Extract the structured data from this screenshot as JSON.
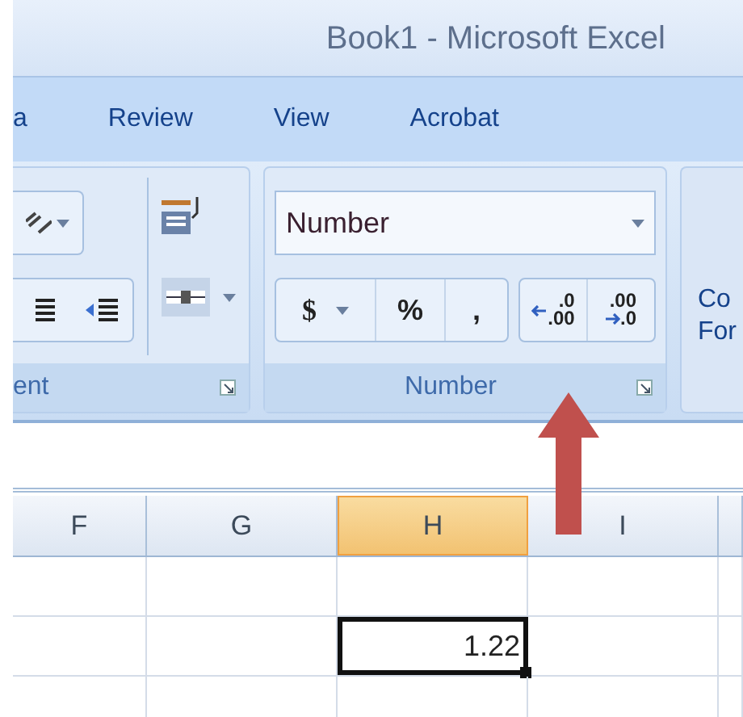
{
  "window": {
    "title": "Book1  -  Microsoft Excel"
  },
  "tabs": [
    {
      "label": "a",
      "selected": false
    },
    {
      "label": "Review",
      "selected": false
    },
    {
      "label": "View",
      "selected": false
    },
    {
      "label": "Acrobat",
      "selected": false
    }
  ],
  "ribbon": {
    "alignment_group": {
      "label": "ent"
    },
    "number_group": {
      "label": "Number",
      "format": "Number",
      "currency": "$",
      "percent": "%",
      "comma": ",",
      "increase_decimal": {
        "top": ".0",
        "bottom": ".00"
      },
      "decrease_decimal": {
        "top": ".00",
        "bottom": ".0"
      }
    },
    "next_group": {
      "lines": [
        "Co",
        "For"
      ]
    }
  },
  "sheet": {
    "columns": [
      {
        "label": "F",
        "selected": false
      },
      {
        "label": "G",
        "selected": false
      },
      {
        "label": "H",
        "selected": true
      },
      {
        "label": "I",
        "selected": false
      },
      {
        "selected": false
      }
    ],
    "rows": [
      {
        "cells": [
          {
            "selected": false
          },
          {
            "selected": false
          },
          {
            "selected": false
          },
          {
            "selected": false
          },
          {
            "selected": false
          }
        ]
      },
      {
        "cells": [
          {
            "selected": false
          },
          {
            "selected": false
          },
          {
            "value": "1.22",
            "selected": true
          },
          {
            "selected": false
          },
          {
            "selected": false
          }
        ]
      },
      {
        "cells": [
          {
            "selected": false
          },
          {
            "selected": false
          },
          {
            "selected": false
          },
          {
            "selected": false
          },
          {
            "selected": false
          }
        ]
      }
    ]
  }
}
